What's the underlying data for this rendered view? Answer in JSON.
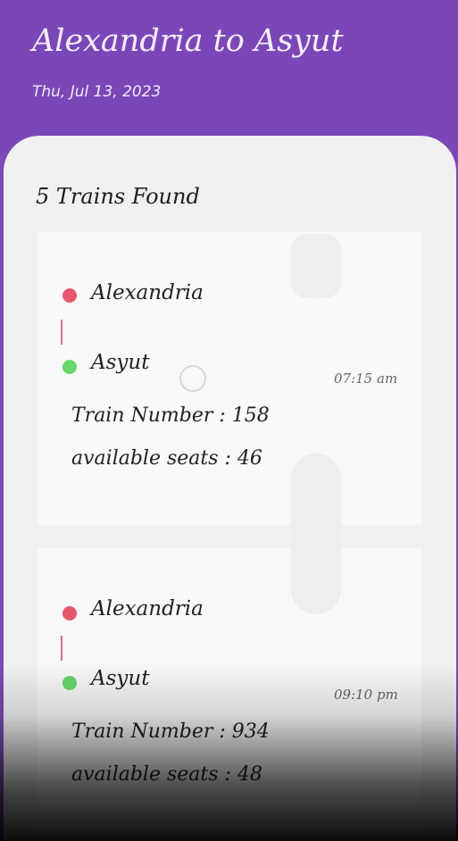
{
  "header": {
    "route_title": "Alexandria to Asyut",
    "date": "Thu, Jul 13, 2023"
  },
  "results": {
    "count_label": "5 Trains Found"
  },
  "trains": [
    {
      "from": "Alexandria",
      "to": "Asyut",
      "time": "07:15 am",
      "train_number": "Train Number : 158",
      "seats": "available seats : 46"
    },
    {
      "from": "Alexandria",
      "to": "Asyut",
      "time": "09:10 pm",
      "train_number": "Train Number : 934",
      "seats": "available seats : 48"
    }
  ],
  "colors": {
    "header": "#7b47b8",
    "origin_dot": "#e8566b",
    "destination_dot": "#66d76a"
  }
}
